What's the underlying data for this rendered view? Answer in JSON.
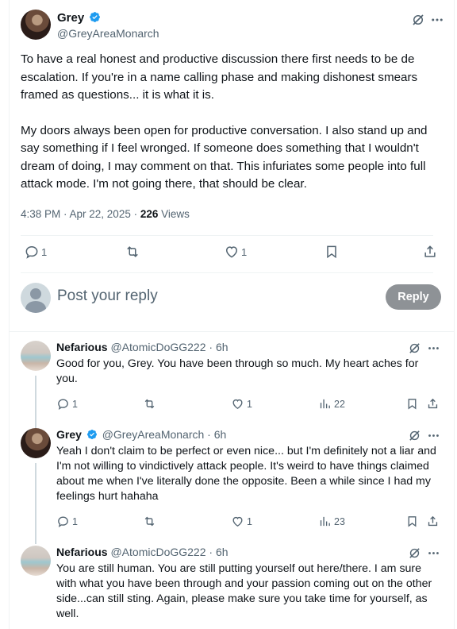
{
  "main_post": {
    "author_name": "Grey",
    "author_handle": "@GreyAreaMonarch",
    "paragraphs": [
      "To have a real honest and productive discussion there first needs to be de escalation. If you're in a name calling phase and making dishonest smears framed as questions... it is what it is.",
      "My doors always been open for productive conversation. I also stand up and say something if I feel wronged. If someone does something that I wouldn't dream of doing, I may comment on that. This infuriates some people into full attack mode. I'm not going there, that should be clear."
    ],
    "timestamp": "4:38 PM · Apr 22, 2025 · ",
    "views_count": "226",
    "views_label": " Views",
    "reply_count": "1",
    "like_count": "1"
  },
  "compose": {
    "placeholder": "Post your reply",
    "reply_button": "Reply"
  },
  "replies": [
    {
      "author_name": "Nefarious",
      "author_handle": "@AtomicDoGG222 · 6h",
      "text": "Good for you, Grey.  You have been through so much.  My heart aches for you.",
      "reply_count": "1",
      "like_count": "1",
      "views": "22"
    },
    {
      "author_name": "Grey",
      "author_handle": "@GreyAreaMonarch · 6h",
      "text": "Yeah I don't claim to be perfect or even nice... but I'm definitely not a liar and I'm not willing to vindictively attack people. It's weird to have things claimed about me when I've literally done the opposite. Been a while since I had my feelings hurt hahaha",
      "reply_count": "1",
      "like_count": "1",
      "views": "23"
    },
    {
      "author_name": "Nefarious",
      "author_handle": "@AtomicDoGG222 · 6h",
      "text": "You are still human.  You are still putting yourself out here/there. I am sure with what you have been through and your passion coming out on the other side...can still sting. Again, please make sure you take time for yourself, as well."
    }
  ],
  "colors": {
    "accent": "#1d9bf0",
    "secondary_text": "#536471",
    "reply_button_bg": "#8e9296"
  }
}
